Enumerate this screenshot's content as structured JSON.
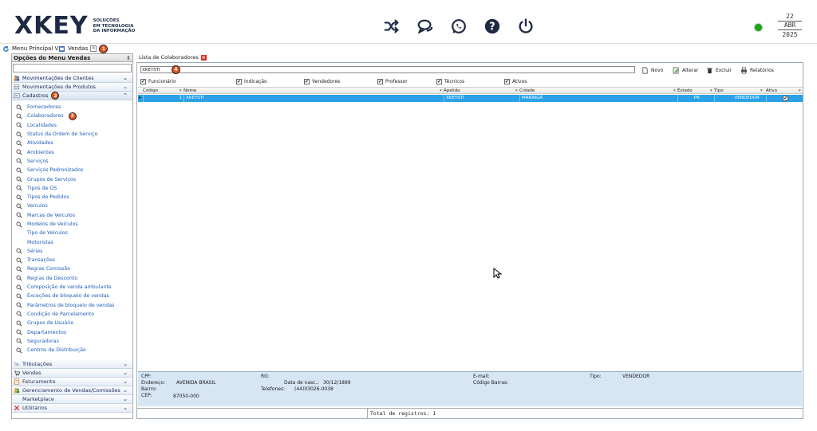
{
  "header": {
    "logo_text": "XKEY",
    "logo_sub": [
      "SOLUÇÕES",
      "EM TECNOLOGIA",
      "DA INFORMAÇÃO"
    ],
    "icons": [
      "shuffle-icon",
      "chat-icon",
      "whatsapp-icon",
      "help-icon",
      "power-icon"
    ],
    "status_color": "#1da31d",
    "date": {
      "day": "22",
      "month": "ABR",
      "year": "2025"
    }
  },
  "tabs": {
    "menu_principal": "Menu Principal V3",
    "vendas": "Vendas",
    "badge1": "1"
  },
  "sidebar": {
    "title": "Opções do Menu Vendas",
    "categories_top": [
      {
        "label": "Movimentações de Clientes",
        "icon": "clients-icon"
      },
      {
        "label": "Movimentações de Produtos",
        "icon": "products-icon"
      }
    ],
    "cadastros": {
      "label": "Cadastros",
      "badge": "2"
    },
    "items": [
      "Fornecedores",
      "Colaboradores",
      "Localidades",
      "Status da Ordem de Serviço",
      "Atividades",
      "Ambientes",
      "Serviços",
      "Serviços Padronizados",
      "Grupos de Serviços",
      "Tipos de OS",
      "Tipos de Pedidos",
      "Veículos",
      "Marcas de Veículos",
      "Modelos de Veículos",
      "Tipo de Veículos",
      "Motoristas",
      "Séries",
      "Transações",
      "Regras Comissão",
      "Regras de Desconto",
      "Composição de venda ambulante",
      "Exceções de bloqueio de vendas",
      "Parâmetros de bloqueio de vendas",
      "Condição de Parcelamento",
      "Grupos de Usuário",
      "Departamentos",
      "Seguradoras",
      "Centros de Distribuição"
    ],
    "colaboradores_badge": "3",
    "categories_bottom": [
      "Tributações",
      "Vendas",
      "Faturamento",
      "Gerenciamento de Vendas/Comissões",
      "Marketplace",
      "Utilitários"
    ]
  },
  "main": {
    "tab_title": "Lista de Colaboradores",
    "search_value": "XKEYSTI",
    "search_badge": "4",
    "toolbar": {
      "novo": "Novo",
      "alterar": "Alterar",
      "excluir": "Excluir",
      "relatorios": "Relatórios"
    },
    "filters": [
      "Funcionário",
      "Indicação",
      "Vendedores",
      "Professor",
      "Técnicos",
      "Ativos"
    ],
    "columns": [
      "Código",
      "Nome",
      "Apelido",
      "Cidade",
      "Estado",
      "Tipo",
      "Ativo"
    ],
    "rows": [
      {
        "codigo": "1",
        "nome": "XKEYSTI",
        "apelido": "XKEYSTI",
        "cidade": "MARINGÁ",
        "estado": "PR",
        "tipo": "VENDEDOR",
        "ativo": "✔"
      }
    ],
    "details": {
      "cpf": "CPF:",
      "endereco_label": "Endereço:",
      "endereco": "AVENIDA BRASIL",
      "bairro": "Bairro:",
      "cep_label": "CEP:",
      "cep": "87050-000",
      "rg": "RG:",
      "nasc_label": "Data de nasc.:",
      "nasc": "30/12/1899",
      "telefones_label": "Telefones:",
      "telefones": "(44)03026-0038",
      "email": "E-mail:",
      "codigo_barras": "Código Barras:",
      "tipo_label": "Tipo:",
      "tipo": "VENDEDOR"
    },
    "total": "Total de registros: 1"
  }
}
